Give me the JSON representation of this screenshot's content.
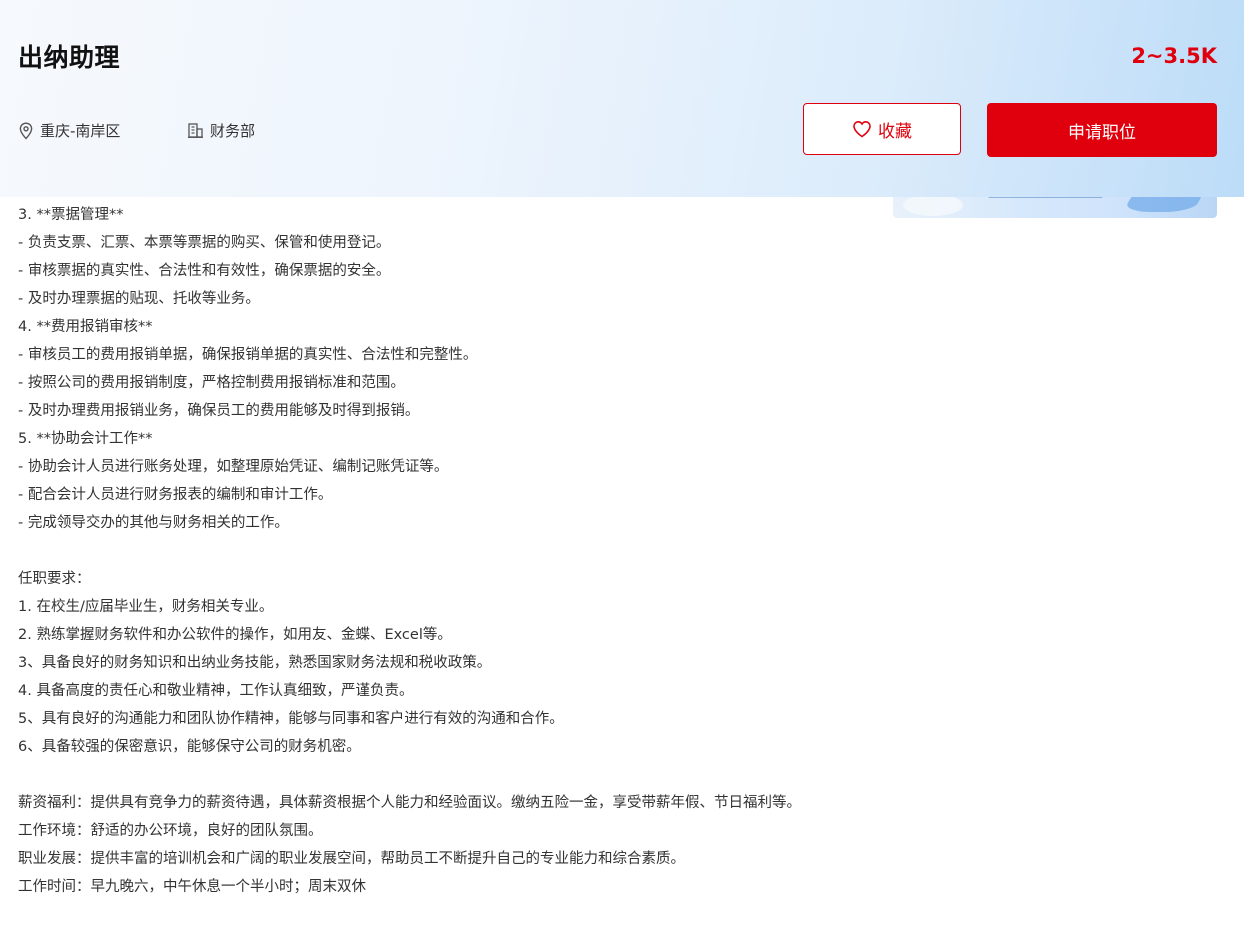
{
  "header": {
    "title": "出纳助理",
    "salary": "2~3.5K",
    "location": "重庆-南岸区",
    "department": "财务部",
    "favorite_label": "收藏",
    "apply_label": "申请职位",
    "icons": {
      "location": "location-pin-icon",
      "department": "building-icon",
      "favorite": "heart-icon"
    },
    "colors": {
      "accent": "#e0000d"
    }
  },
  "description": {
    "lines": [
      "3. **票据管理**",
      " - 负责支票、汇票、本票等票据的购买、保管和使用登记。",
      " - 审核票据的真实性、合法性和有效性，确保票据的安全。",
      " - 及时办理票据的贴现、托收等业务。",
      "4. **费用报销审核**",
      " - 审核员工的费用报销单据，确保报销单据的真实性、合法性和完整性。",
      " - 按照公司的费用报销制度，严格控制费用报销标准和范围。",
      " - 及时办理费用报销业务，确保员工的费用能够及时得到报销。",
      "5. **协助会计工作**",
      " - 协助会计人员进行账务处理，如整理原始凭证、编制记账凭证等。",
      " - 配合会计人员进行财务报表的编制和审计工作。",
      " - 完成领导交办的其他与财务相关的工作。"
    ],
    "requirements_title": "任职要求：",
    "requirements": [
      "1. 在校生/应届毕业生，财务相关专业。",
      "2. 熟练掌握财务软件和办公软件的操作，如用友、金蝶、Excel等。",
      "3、具备良好的财务知识和出纳业务技能，熟悉国家财务法规和税收政策。",
      "4. 具备高度的责任心和敬业精神，工作认真细致，严谨负责。",
      "5、具有良好的沟通能力和团队协作精神，能够与同事和客户进行有效的沟通和合作。",
      "6、具备较强的保密意识，能够保守公司的财务机密。"
    ],
    "benefits": "薪资福利：提供具有竞争力的薪资待遇，具体薪资根据个人能力和经验面议。缴纳五险一金，享受带薪年假、节日福利等。",
    "environment": "工作环境：舒适的办公环境，良好的团队氛围。",
    "development": "职业发展：提供丰富的培训机会和广阔的职业发展空间，帮助员工不断提升自己的专业能力和综合素质。",
    "hours": "工作时间：早九晚六，中午休息一个半小时；周末双休"
  }
}
